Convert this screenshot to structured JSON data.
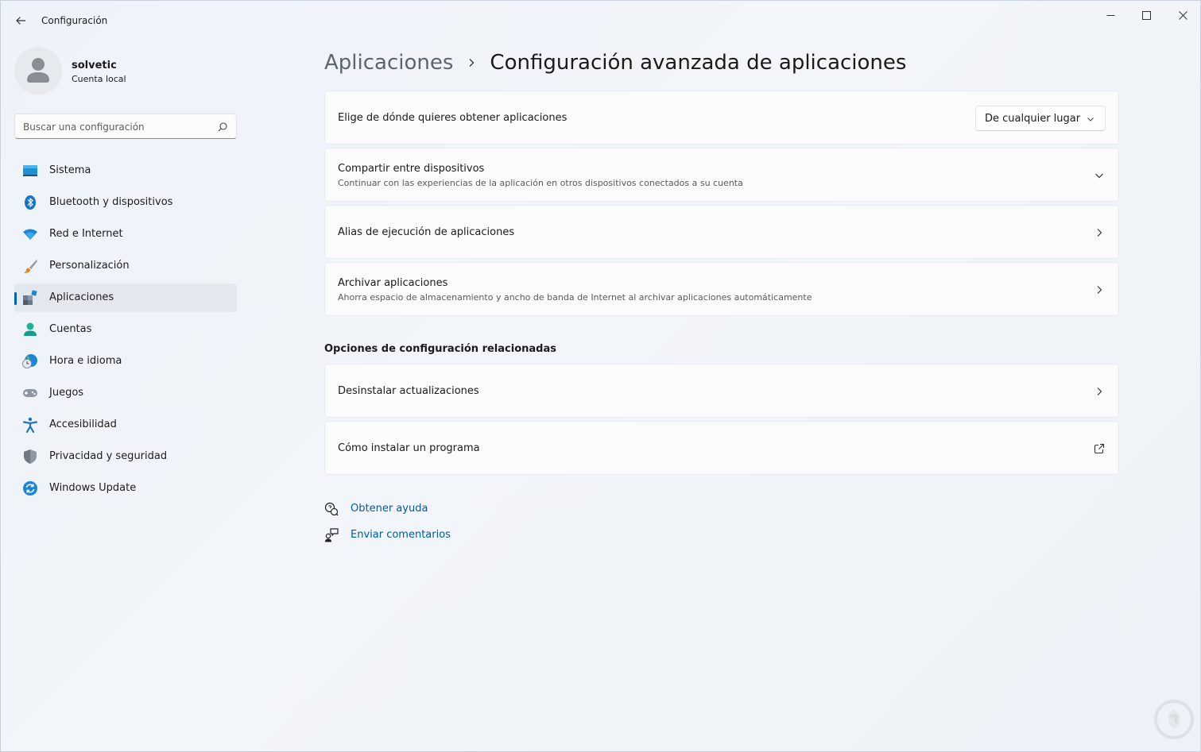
{
  "window": {
    "app_title": "Configuración",
    "back_icon": "arrow-left-icon",
    "controls": [
      "minimize-icon",
      "maximize-icon",
      "close-icon"
    ]
  },
  "profile": {
    "name": "solvetic",
    "account_type": "Cuenta local"
  },
  "search": {
    "placeholder": "Buscar una configuración",
    "value": ""
  },
  "nav": {
    "selected": "Aplicaciones",
    "accent": "#005fb8",
    "items": [
      {
        "label": "Sistema",
        "icon": "monitor-icon"
      },
      {
        "label": "Bluetooth y dispositivos",
        "icon": "bluetooth-icon"
      },
      {
        "label": "Red e Internet",
        "icon": "wifi-icon"
      },
      {
        "label": "Personalización",
        "icon": "paintbrush-icon"
      },
      {
        "label": "Aplicaciones",
        "icon": "apps-icon"
      },
      {
        "label": "Cuentas",
        "icon": "person-icon"
      },
      {
        "label": "Hora e idioma",
        "icon": "clock-globe-icon"
      },
      {
        "label": "Juegos",
        "icon": "gamepad-icon"
      },
      {
        "label": "Accesibilidad",
        "icon": "accessibility-icon"
      },
      {
        "label": "Privacidad y seguridad",
        "icon": "shield-icon"
      },
      {
        "label": "Windows Update",
        "icon": "sync-icon"
      }
    ]
  },
  "breadcrumb": {
    "parent": "Aplicaciones",
    "current": "Configuración avanzada de aplicaciones"
  },
  "settings": [
    {
      "title": "Elige de dónde quieres obtener aplicaciones",
      "control": "dropdown",
      "value": "De cualquier lugar"
    },
    {
      "title": "Compartir entre dispositivos",
      "subtitle": "Continuar con las experiencias de la aplicación en otros dispositivos conectados a su cuenta",
      "control": "expand"
    },
    {
      "title": "Alias de ejecución de aplicaciones",
      "control": "navigate"
    },
    {
      "title": "Archivar aplicaciones",
      "subtitle": "Ahorra espacio de almacenamiento y ancho de banda de Internet al archivar aplicaciones automáticamente",
      "control": "navigate"
    }
  ],
  "related": {
    "heading": "Opciones de configuración relacionadas",
    "items": [
      {
        "title": "Desinstalar actualizaciones",
        "control": "navigate"
      },
      {
        "title": "Cómo instalar un programa",
        "control": "external-link"
      }
    ]
  },
  "help": {
    "get_help": "Obtener ayuda",
    "feedback": "Enviar comentarios"
  }
}
